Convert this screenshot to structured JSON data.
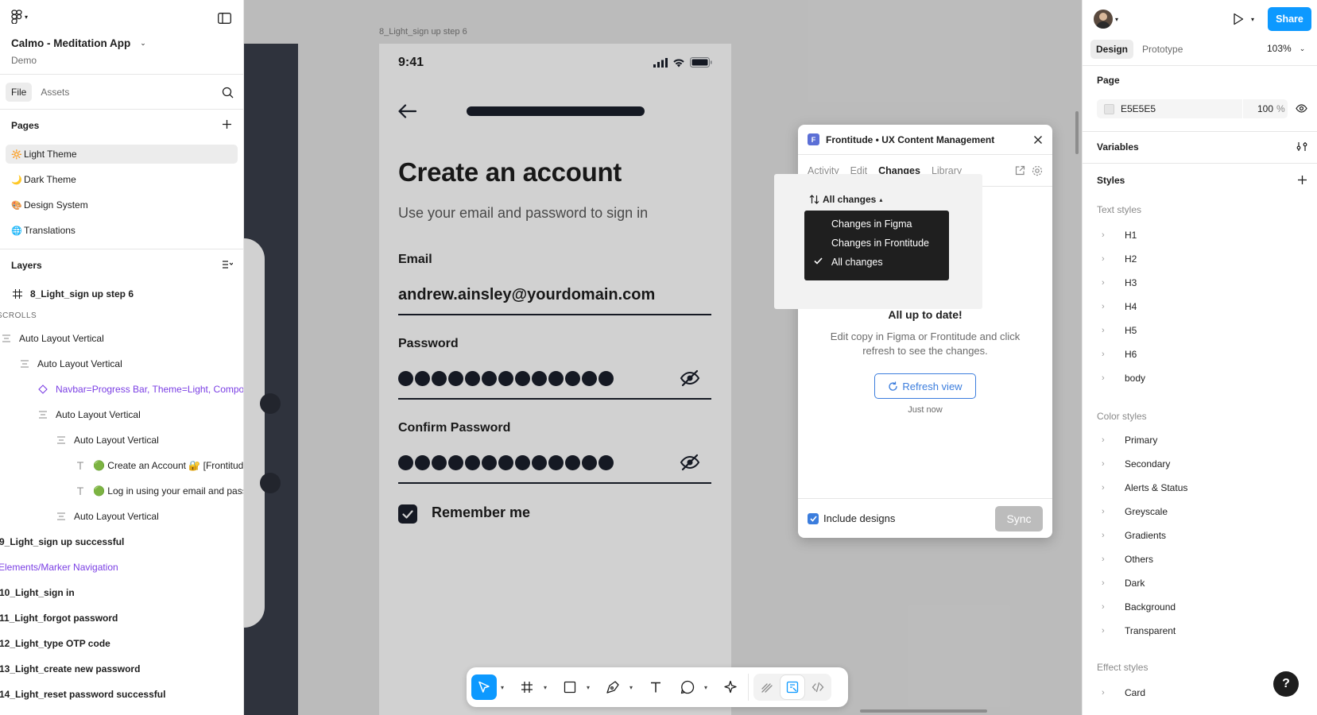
{
  "left_panel": {
    "project_name": "Calmo - Meditation App",
    "team": "Demo",
    "tabs": [
      "File",
      "Assets"
    ],
    "pages_title": "Pages",
    "pages": [
      {
        "emoji": "🔆",
        "label": "Light Theme",
        "selected": true
      },
      {
        "emoji": "🌙",
        "label": "Dark Theme",
        "selected": false
      },
      {
        "emoji": "🎨",
        "label": "Design System",
        "selected": false
      },
      {
        "emoji": "🌐",
        "label": "Translations",
        "selected": false
      }
    ],
    "layers_title": "Layers",
    "layers": [
      {
        "icon": "frame-icon",
        "label": "8_Light_sign up step 6"
      },
      {
        "icon": "none",
        "label": "SCROLLS"
      },
      {
        "icon": "auto-layout-icon",
        "label": "Auto Layout Vertical"
      },
      {
        "icon": "auto-layout-icon",
        "label": "Auto Layout Vertical"
      },
      {
        "icon": "component-instance-icon",
        "label": "Navbar=Progress Bar, Theme=Light, Compon"
      },
      {
        "icon": "auto-layout-icon",
        "label": "Auto Layout Vertical"
      },
      {
        "icon": "auto-layout-icon",
        "label": "Auto Layout Vertical"
      },
      {
        "icon": "text-icon",
        "label": "🟢 Create an Account 🔐 [Frontitud"
      },
      {
        "icon": "text-icon",
        "label": "🟢 Log in using your email and pass"
      },
      {
        "icon": "auto-layout-icon",
        "label": "Auto Layout Vertical"
      },
      {
        "icon": "none",
        "label": "9_Light_sign up successful"
      },
      {
        "icon": "none",
        "label": "Elements/Marker Navigation"
      },
      {
        "icon": "none",
        "label": "10_Light_sign in"
      },
      {
        "icon": "none",
        "label": "11_Light_forgot password"
      },
      {
        "icon": "none",
        "label": "12_Light_type OTP code"
      },
      {
        "icon": "none",
        "label": "13_Light_create new password"
      },
      {
        "icon": "none",
        "label": "14_Light_reset password successful"
      }
    ]
  },
  "canvas": {
    "frame_label": "8_Light_sign up step 6",
    "phone": {
      "time": "9:41",
      "heading": "Create an account",
      "subheading": "Use your email and password to sign in",
      "email_label": "Email",
      "email_value": "andrew.ainsley@yourdomain.com",
      "password_label": "Password",
      "confirm_label": "Confirm Password",
      "remember": "Remember me"
    }
  },
  "plugin": {
    "title": "Frontitude • UX Content Management",
    "tabs": [
      "Activity",
      "Edit",
      "Changes",
      "Library"
    ],
    "active_tab": "Changes",
    "sort_label": "All changes",
    "menu": [
      {
        "label": "Changes in Figma",
        "checked": false
      },
      {
        "label": "Changes in Frontitude",
        "checked": false
      },
      {
        "label": "All changes",
        "checked": true
      }
    ],
    "up_to_date": "All up to date!",
    "description": "Edit copy in Figma or Frontitude and click refresh to see the changes.",
    "refresh_label": "Refresh view",
    "refreshed": "Just now",
    "include_designs": "Include designs",
    "sync_label": "Sync"
  },
  "right_panel": {
    "share": "Share",
    "tabs": [
      "Design",
      "Prototype"
    ],
    "zoom": "103%",
    "page_title": "Page",
    "page_color": "E5E5E5",
    "page_opacity": "100",
    "percent": "%",
    "variables": "Variables",
    "styles_title": "Styles",
    "text_styles_title": "Text styles",
    "text_styles": [
      "H1",
      "H2",
      "H3",
      "H4",
      "H5",
      "H6",
      "body"
    ],
    "color_styles_title": "Color styles",
    "color_styles": [
      "Primary",
      "Secondary",
      "Alerts & Status",
      "Greyscale",
      "Gradients",
      "Others",
      "Dark",
      "Background",
      "Transparent"
    ],
    "effect_styles_title": "Effect styles",
    "effect_styles": [
      "Card"
    ],
    "help": "?"
  },
  "colors": {
    "accent": "#0d99ff",
    "plugin_accent": "#3b7ddd",
    "phone_dark": "#1a1f2b",
    "component_purple": "#7b3fe4"
  }
}
